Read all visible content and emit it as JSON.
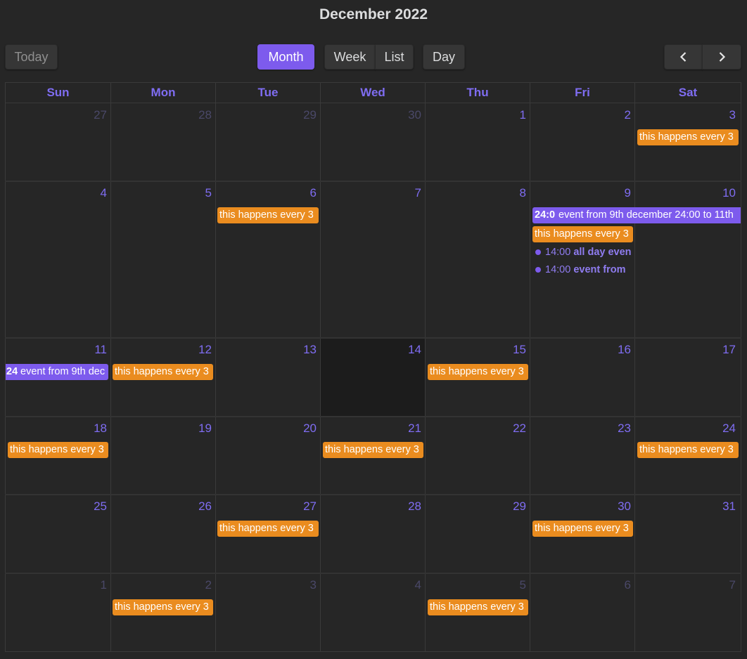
{
  "title": "December 2022",
  "toolbar": {
    "today": "Today",
    "month": "Month",
    "week": "Week",
    "list": "List",
    "day": "Day"
  },
  "weekdays": [
    "Sun",
    "Mon",
    "Tue",
    "Wed",
    "Thu",
    "Fri",
    "Sat"
  ],
  "weeks": [
    [
      "27",
      "28",
      "29",
      "30",
      "1",
      "2",
      "3"
    ],
    [
      "4",
      "5",
      "6",
      "7",
      "8",
      "9",
      "10"
    ],
    [
      "11",
      "12",
      "13",
      "14",
      "15",
      "16",
      "17"
    ],
    [
      "18",
      "19",
      "20",
      "21",
      "22",
      "23",
      "24"
    ],
    [
      "25",
      "26",
      "27",
      "28",
      "29",
      "30",
      "31"
    ],
    [
      "1",
      "2",
      "3",
      "4",
      "5",
      "6",
      "7"
    ]
  ],
  "events": {
    "recurring": "this happens every 3",
    "multi_day_time": "24:0",
    "multi_day_time_short": "24",
    "multi_day_title": "event from 9th december 24:00 to 11th",
    "multi_day_title_cont": "event from 9th dec",
    "dot1_time": "14:00",
    "dot1_title": "all day even",
    "dot2_time": "14:00",
    "dot2_title": "event from"
  },
  "colors": {
    "accent": "#7d5bed",
    "event_orange": "#ea8c1f",
    "background": "#262626",
    "today_bg": "#1c1c1c"
  }
}
